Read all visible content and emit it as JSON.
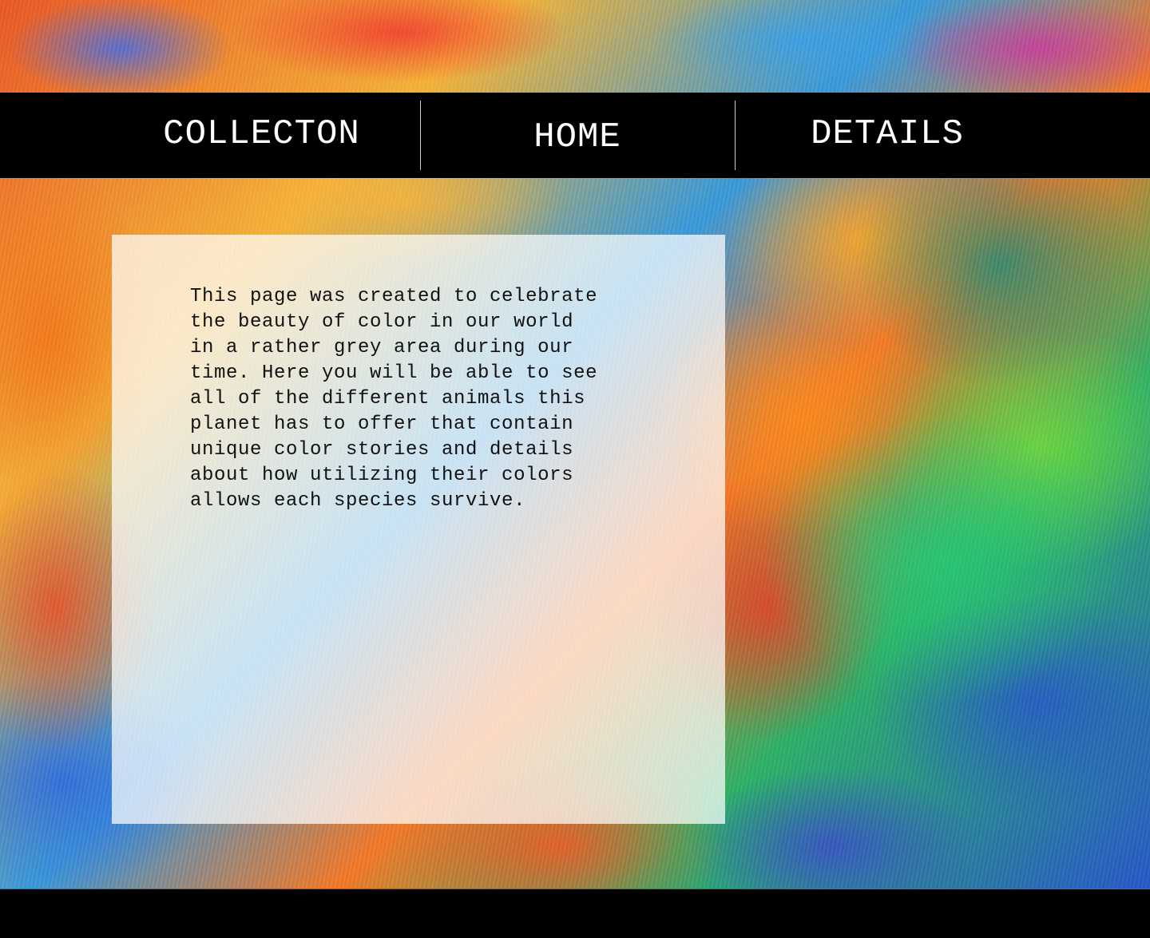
{
  "nav": {
    "items": [
      {
        "label": "COLLECTON"
      },
      {
        "label": "HOME"
      },
      {
        "label": "DETAILS"
      }
    ]
  },
  "main": {
    "intro_text": "This page was created to celebrate\nthe beauty of color in our world\nin a rather grey area during our\ntime. Here you will be able to see\nall of the different animals this\nplanet has to offer that contain\nunique color stories and details\nabout how utilizing their colors\nallows each species survive."
  },
  "colors": {
    "nav_background": "#000000",
    "nav_text": "#ffffff",
    "panel_background": "rgba(255,255,255,0.72)",
    "body_text": "#111111"
  }
}
